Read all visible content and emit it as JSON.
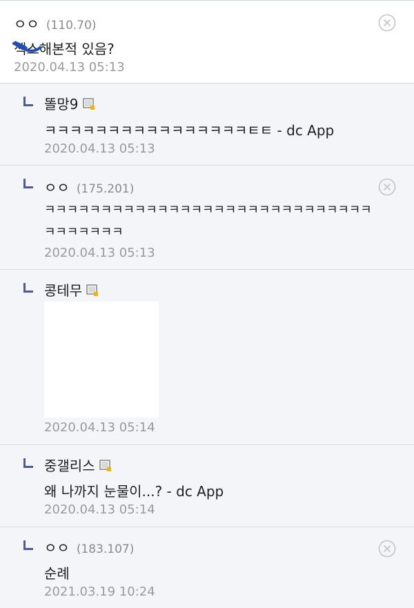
{
  "comments": [
    {
      "nick": "ㅇㅇ",
      "ip": "(110.70)",
      "text": "섹스해본적 있음?",
      "date": "2020.04.13 05:13"
    },
    {
      "nick": "똘망9",
      "text": "ㅋㅋㅋㅋㅋㅋㅋㅋㅋㅋㅋㅋㅋㅋㅋㅋㅌㅌ - dc App",
      "date": "2020.04.13 05:13"
    },
    {
      "nick": "ㅇㅇ",
      "ip": "(175.201)",
      "text_line1": "ㅋㅋㅋㅋㅋㅋㅋㅋㅋㅋㅋㅋㅋㅋㅋㅋㅋㅋㅋㅋㅋㅋㅋㅋㅋㅋㅋㅋㅋ",
      "text_line2": "ㅋㅋㅋㅋㅋㅋㅋ",
      "date": "2020.04.13 05:13"
    },
    {
      "nick": "콩테무",
      "date": "2020.04.13 05:14"
    },
    {
      "nick": "중갤리스",
      "text": "왜 나까지 눈물이...? - dc App",
      "date": "2020.04.13 05:14"
    },
    {
      "nick": "ㅇㅇ",
      "ip": "(183.107)",
      "text": "순례",
      "date": "2021.03.19 10:24"
    }
  ],
  "colors": {
    "reply_bg": "#f3f5f9",
    "reply_mark": "#4a5a9a",
    "date": "#9a9a9a",
    "ip": "#8a8a8a"
  },
  "icons": {
    "delete": "circle-x-icon",
    "gallog": "gallog-badge-icon",
    "reply": "reply-arrow-icon"
  }
}
